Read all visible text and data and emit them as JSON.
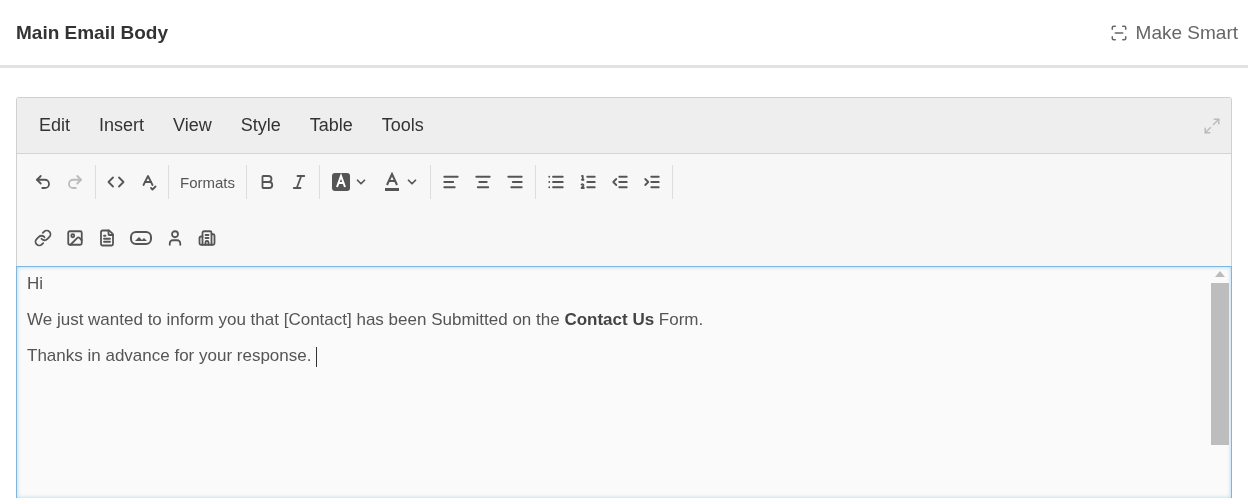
{
  "header": {
    "title": "Main Email Body",
    "action": "Make Smart"
  },
  "editor": {
    "menu": [
      "Edit",
      "Insert",
      "View",
      "Style",
      "Table",
      "Tools"
    ],
    "toolbars": [
      {
        "groups": [
          [
            {
              "kind": "icon",
              "disabled": false
            },
            {
              "kind": "icon",
              "disabled": true
            }
          ],
          [
            {
              "kind": "icon",
              "disabled": false
            },
            {
              "kind": "icon",
              "disabled": false
            }
          ],
          [
            {
              "kind": "text",
              "label": "Formats",
              "disabled": false
            }
          ],
          [
            {
              "kind": "icon",
              "disabled": false
            },
            {
              "kind": "icon",
              "disabled": false
            }
          ],
          [
            {
              "kind": "split",
              "disabled": false
            },
            {
              "kind": "split",
              "disabled": false
            }
          ],
          [
            {
              "kind": "icon",
              "disabled": false
            },
            {
              "kind": "icon",
              "disabled": false
            },
            {
              "kind": "icon",
              "disabled": false
            }
          ],
          [
            {
              "kind": "icon",
              "disabled": false
            },
            {
              "kind": "icon",
              "disabled": false
            },
            {
              "kind": "icon",
              "disabled": false
            },
            {
              "kind": "icon",
              "disabled": false
            }
          ]
        ]
      },
      {
        "groups": [
          [
            {
              "kind": "icon",
              "disabled": false
            },
            {
              "kind": "icon",
              "disabled": false
            },
            {
              "kind": "icon",
              "disabled": false
            },
            {
              "kind": "icon",
              "disabled": false
            },
            {
              "kind": "icon",
              "disabled": false
            },
            {
              "kind": "icon",
              "disabled": false
            }
          ]
        ]
      }
    ],
    "paragraphs": [
      "Hi",
      "We just wanted to inform you that [Contact] has been Submitted on the **Contact Us** Form.",
      "Thanks in advance for your response. "
    ],
    "focused": true
  }
}
